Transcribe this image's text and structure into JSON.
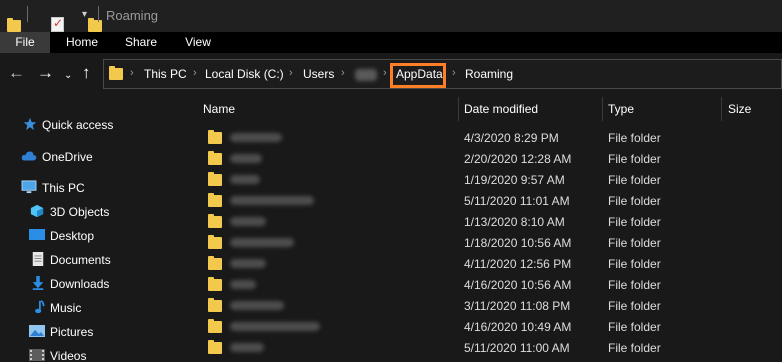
{
  "window": {
    "title": "Roaming"
  },
  "ribbon": {
    "tabs": [
      "File",
      "Home",
      "Share",
      "View"
    ]
  },
  "nav": {
    "back": "←",
    "forward": "→",
    "history": "⌄",
    "up": "↑"
  },
  "address": {
    "crumbs": [
      "This PC",
      "Local Disk (C:)",
      "Users",
      "AppData",
      "Roaming"
    ],
    "separator": "›",
    "highlight_color": "#ff7f27"
  },
  "sidebar": {
    "items": [
      {
        "label": "Quick access",
        "icon": "star-icon"
      },
      {
        "label": "OneDrive",
        "icon": "cloud-icon"
      },
      {
        "label": "This PC",
        "icon": "monitor-icon"
      },
      {
        "label": "3D Objects",
        "icon": "cube-icon"
      },
      {
        "label": "Desktop",
        "icon": "desktop-icon"
      },
      {
        "label": "Documents",
        "icon": "documents-icon"
      },
      {
        "label": "Downloads",
        "icon": "download-icon"
      },
      {
        "label": "Music",
        "icon": "music-icon"
      },
      {
        "label": "Pictures",
        "icon": "pictures-icon"
      },
      {
        "label": "Videos",
        "icon": "videos-icon"
      }
    ]
  },
  "list": {
    "columns": {
      "name": "Name",
      "date": "Date modified",
      "type": "Type",
      "size": "Size"
    },
    "rows": [
      {
        "date": "4/3/2020 8:29 PM",
        "type": "File folder"
      },
      {
        "date": "2/20/2020 12:28 AM",
        "type": "File folder"
      },
      {
        "date": "1/19/2020 9:57 AM",
        "type": "File folder"
      },
      {
        "date": "5/11/2020 11:01 AM",
        "type": "File folder"
      },
      {
        "date": "1/13/2020 8:10 AM",
        "type": "File folder"
      },
      {
        "date": "1/18/2020 10:56 AM",
        "type": "File folder"
      },
      {
        "date": "4/11/2020 12:56 PM",
        "type": "File folder"
      },
      {
        "date": "4/16/2020 10:56 AM",
        "type": "File folder"
      },
      {
        "date": "3/11/2020 11:08 PM",
        "type": "File folder"
      },
      {
        "date": "4/16/2020 10:49 AM",
        "type": "File folder"
      },
      {
        "date": "5/11/2020 11:00 AM",
        "type": "File folder"
      }
    ]
  },
  "colors": {
    "folder": "#f2c94c",
    "background": "#191919",
    "accent_highlight": "#ff7f27"
  }
}
